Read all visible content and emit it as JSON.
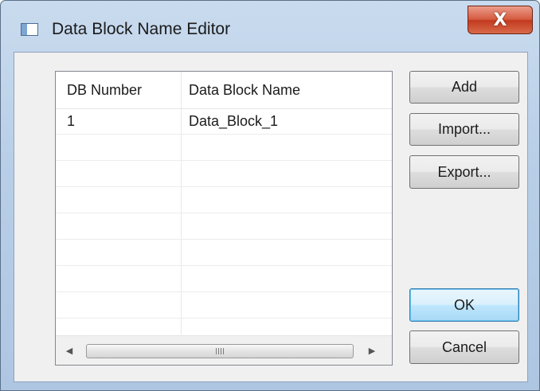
{
  "window": {
    "title": "Data Block Name Editor",
    "close_glyph": "X"
  },
  "table": {
    "columns": [
      "DB Number",
      "Data Block Name"
    ],
    "rows": [
      [
        "1",
        "Data_Block_1"
      ],
      [
        "",
        ""
      ],
      [
        "",
        ""
      ],
      [
        "",
        ""
      ],
      [
        "",
        ""
      ],
      [
        "",
        ""
      ],
      [
        "",
        ""
      ],
      [
        "",
        ""
      ],
      [
        "",
        ""
      ]
    ],
    "scroll_left_glyph": "◀",
    "scroll_right_glyph": "▶"
  },
  "buttons": {
    "add": "Add",
    "import": "Import...",
    "export": "Export...",
    "ok": "OK",
    "cancel": "Cancel"
  },
  "colors": {
    "title_gradient": "#b9cfe8",
    "close_button": "#c23a1f",
    "default_button": "#bee6fd"
  }
}
